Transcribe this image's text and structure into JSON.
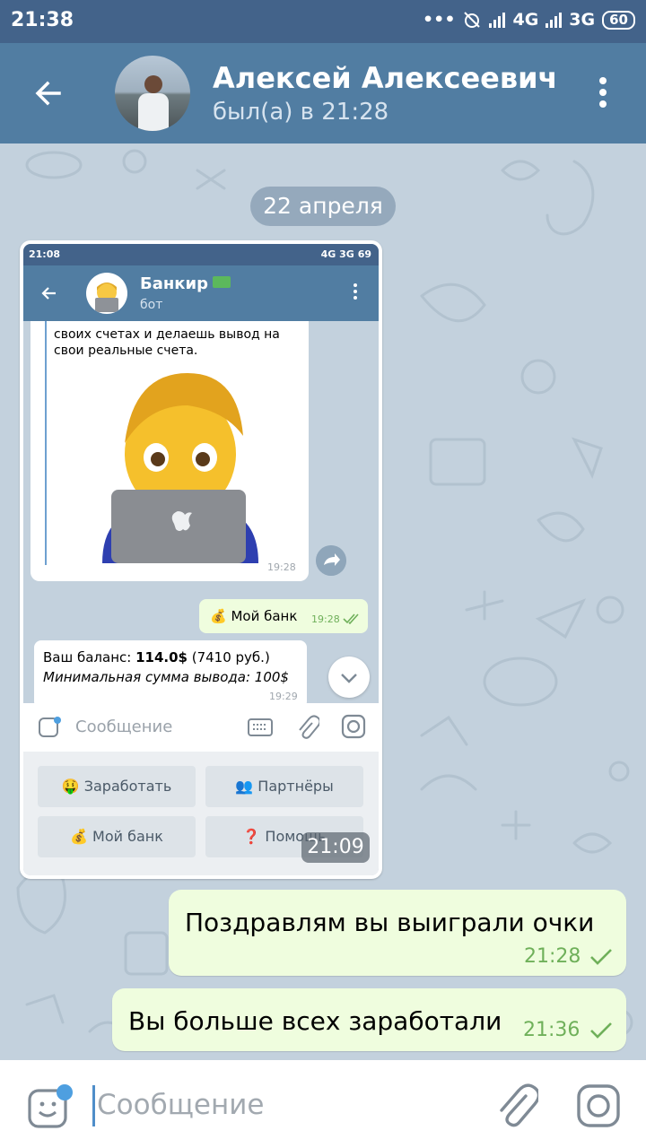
{
  "status_bar": {
    "time": "21:38",
    "network_1": "4G",
    "network_2": "3G",
    "battery": "60"
  },
  "header": {
    "name": "Алексей Алексеевич",
    "status": "был(а) в 21:28"
  },
  "chat": {
    "date_label": "22 апреля",
    "forwarded_screenshot": {
      "time": "21:09",
      "status_time": "21:08",
      "status_network_1": "4G",
      "status_network_2": "3G",
      "status_battery": "69",
      "bot_name": "Банкир",
      "bot_label": "бот",
      "message_text_1": "своих счетах и делаешь вывод на",
      "message_text_2": "свои реальные счета.",
      "message_time": "19:28",
      "my_bank_message": "💰 Мой банк",
      "my_bank_time": "19:28",
      "balance_prefix": "Ваш баланс: ",
      "balance_value": "114.0$",
      "balance_rub": " (7410 руб.)",
      "min_withdraw": "Минимальная сумма вывода: 100$",
      "balance_time": "19:29",
      "input_placeholder": "Сообщение",
      "keyboard": [
        "🤑 Заработать",
        "👥 Партнёры",
        "💰 Мой банк",
        "❓ Помощь"
      ]
    },
    "messages": [
      {
        "text": "Поздравлям вы выиграли очки",
        "time": "21:28"
      },
      {
        "text": "Вы больше всех заработали",
        "time": "21:36"
      }
    ]
  },
  "input": {
    "placeholder": "Сообщение"
  },
  "colors": {
    "header": "#517da2",
    "status_bar": "#43638a",
    "chat_background": "#c3d1dd",
    "outgoing_bubble": "#effdde",
    "time_green": "#6fb05a"
  },
  "icons": [
    "back-arrow-icon",
    "more-vert-icon",
    "forward-icon",
    "chevron-down-icon",
    "sticker-icon",
    "keyboard-icon",
    "attach-icon",
    "camera-icon",
    "double-check-icon",
    "check-icon"
  ]
}
